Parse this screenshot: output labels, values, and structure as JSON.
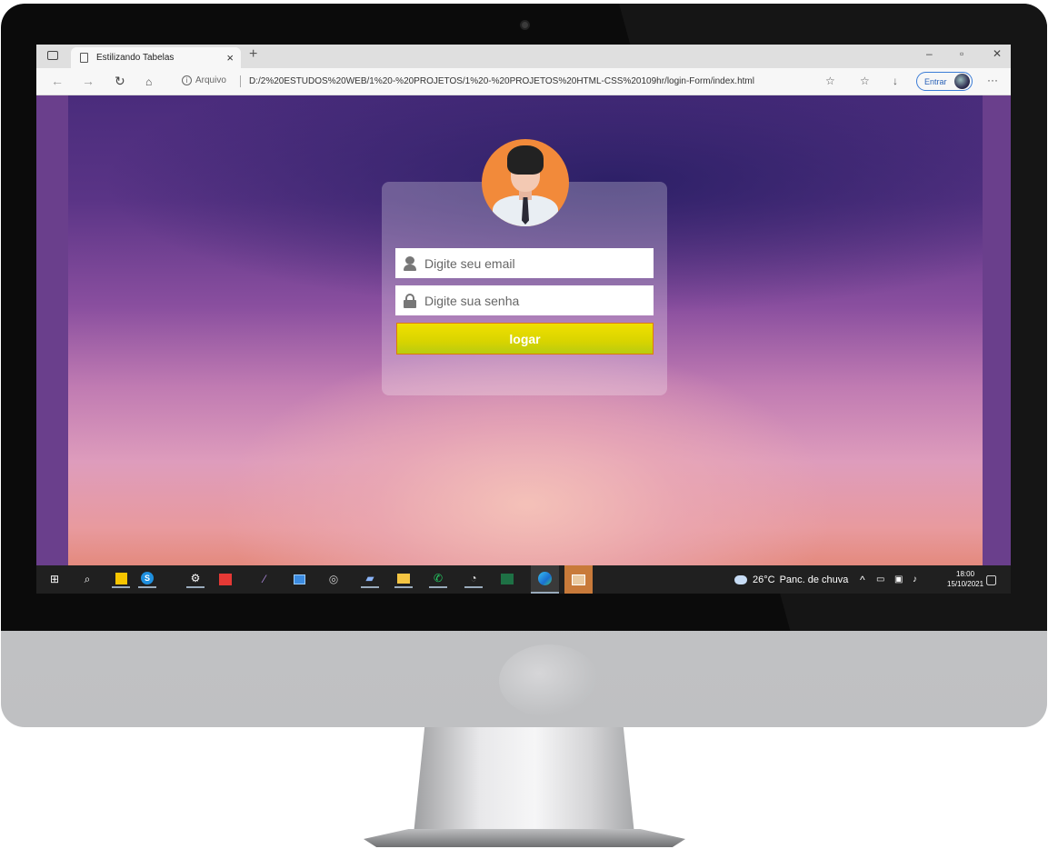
{
  "browser": {
    "tab_title": "Estilizando Tabelas",
    "tab_close": "×",
    "new_tab": "+",
    "window_controls": {
      "minimize": "–",
      "restore": "▫",
      "close": "✕"
    },
    "info_label": "Arquivo",
    "url": "D:/2%20ESTUDOS%20WEB/1%20-%20PROJETOS/1%20-%20PROJETOS%20HTML-CSS%20109hr/login-Form/index.html",
    "signin_label": "Entrar",
    "more": "···"
  },
  "login": {
    "email_placeholder": "Digite seu email",
    "password_placeholder": "Digite sua senha",
    "submit_label": "logar"
  },
  "taskbar": {
    "weather_temp": "26°C",
    "weather_text": "Panc. de chuva",
    "time": "18:00",
    "date": "15/10/2021",
    "apps": [
      "start-icon",
      "search-icon",
      "sticky-notes-icon",
      "skype-icon",
      "settings-icon",
      "anydesk-icon",
      "feather-icon",
      "monitor-icon",
      "obs-icon",
      "pen-icon",
      "file-explorer-icon",
      "whatsapp-icon",
      "steam-icon",
      "excel-icon",
      "edge-icon",
      "paint-icon"
    ]
  },
  "colors": {
    "accent_button": "#e8dc00",
    "button_border": "#e07a00",
    "avatar_bg": "#f28a3a",
    "taskbar_bg": "#202020"
  }
}
